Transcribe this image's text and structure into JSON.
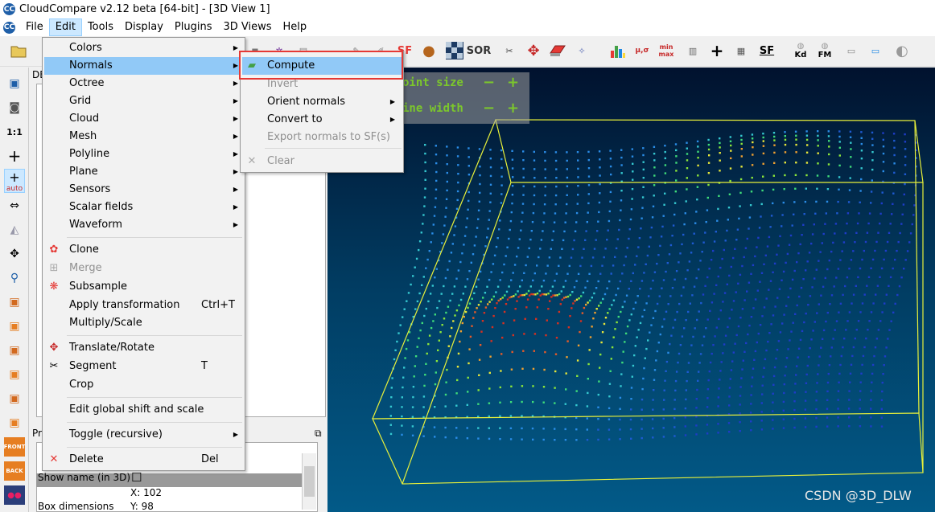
{
  "window": {
    "title": "CloudCompare v2.12 beta [64-bit] - [3D View 1]",
    "logo": "CC"
  },
  "menubar": {
    "items": [
      "File",
      "Edit",
      "Tools",
      "Display",
      "Plugins",
      "3D Views",
      "Help"
    ],
    "active": "Edit"
  },
  "toolbar_icons": [
    "open-icon",
    "save-icon",
    "sf-icon",
    "bomb-icon",
    "checker-icon",
    "sor-icon",
    "segment-icon",
    "move-icon",
    "plane-icon",
    "compass-icon",
    "histogram-icon",
    "mu-sigma-icon",
    "min-max-icon",
    "filter-icon",
    "plus-icon",
    "calculator-icon",
    "sf-text-icon",
    "globe-icon",
    "kd-icon",
    "fm-icon",
    "sf-arith-icon",
    "csv-icon",
    "sphere-icon"
  ],
  "toolbar_labels": {
    "sf": "SF",
    "sor": "SOR",
    "kd": "Kd",
    "fm": "FM",
    "min": "min",
    "max": "max",
    "mu": "μ,σ",
    "sfbig": "SF"
  },
  "leftbar": {
    "ratio_label": "1:1",
    "auto_label": "auto",
    "front_label": "FRONT",
    "back_label": "BACK"
  },
  "panels": {
    "db_title": "DB",
    "properties_title": "Pr",
    "show_name_label": "Show name (in 3D)",
    "box_dimensions_label": "Box dimensions",
    "x_value": "X: 102",
    "y_value": "Y: 98"
  },
  "edit_menu": {
    "items": [
      {
        "label": "Colors",
        "submenu": true
      },
      {
        "label": "Normals",
        "submenu": true,
        "selected": true
      },
      {
        "label": "Octree",
        "submenu": true
      },
      {
        "label": "Grid",
        "submenu": true
      },
      {
        "label": "Cloud",
        "submenu": true
      },
      {
        "label": "Mesh",
        "submenu": true
      },
      {
        "label": "Polyline",
        "submenu": true
      },
      {
        "label": "Plane",
        "submenu": true
      },
      {
        "label": "Sensors",
        "submenu": true
      },
      {
        "label": "Scalar fields",
        "submenu": true
      },
      {
        "label": "Waveform",
        "submenu": true
      },
      {
        "label": "Clone"
      },
      {
        "label": "Merge",
        "disabled": true
      },
      {
        "label": "Subsample"
      },
      {
        "label": "Apply transformation",
        "shortcut": "Ctrl+T"
      },
      {
        "label": "Multiply/Scale"
      },
      {
        "label": "Translate/Rotate"
      },
      {
        "label": "Segment",
        "shortcut": "T"
      },
      {
        "label": "Crop"
      },
      {
        "label": "Edit global shift and scale"
      },
      {
        "label": "Toggle (recursive)",
        "submenu": true
      },
      {
        "label": "Delete",
        "shortcut": "Del"
      }
    ]
  },
  "normals_submenu": {
    "items": [
      {
        "label": "Compute",
        "selected": true
      },
      {
        "label": "Invert",
        "disabled": true
      },
      {
        "label": "Orient normals",
        "submenu": true
      },
      {
        "label": "Convert to",
        "submenu": true
      },
      {
        "label": "Export normals to SF(s)",
        "disabled": true
      },
      {
        "label": "Clear",
        "disabled": true
      }
    ]
  },
  "view3d": {
    "overlay": {
      "point_size_label": "oint size",
      "line_width_label": "ine width",
      "minus": "−",
      "plus": "+"
    },
    "watermark": "CSDN @3D_DLW"
  },
  "arrow_glyph": "▶",
  "checkbox_glyph": "☐",
  "combo_glyph": "⌄",
  "restore_glyph": "⧉"
}
